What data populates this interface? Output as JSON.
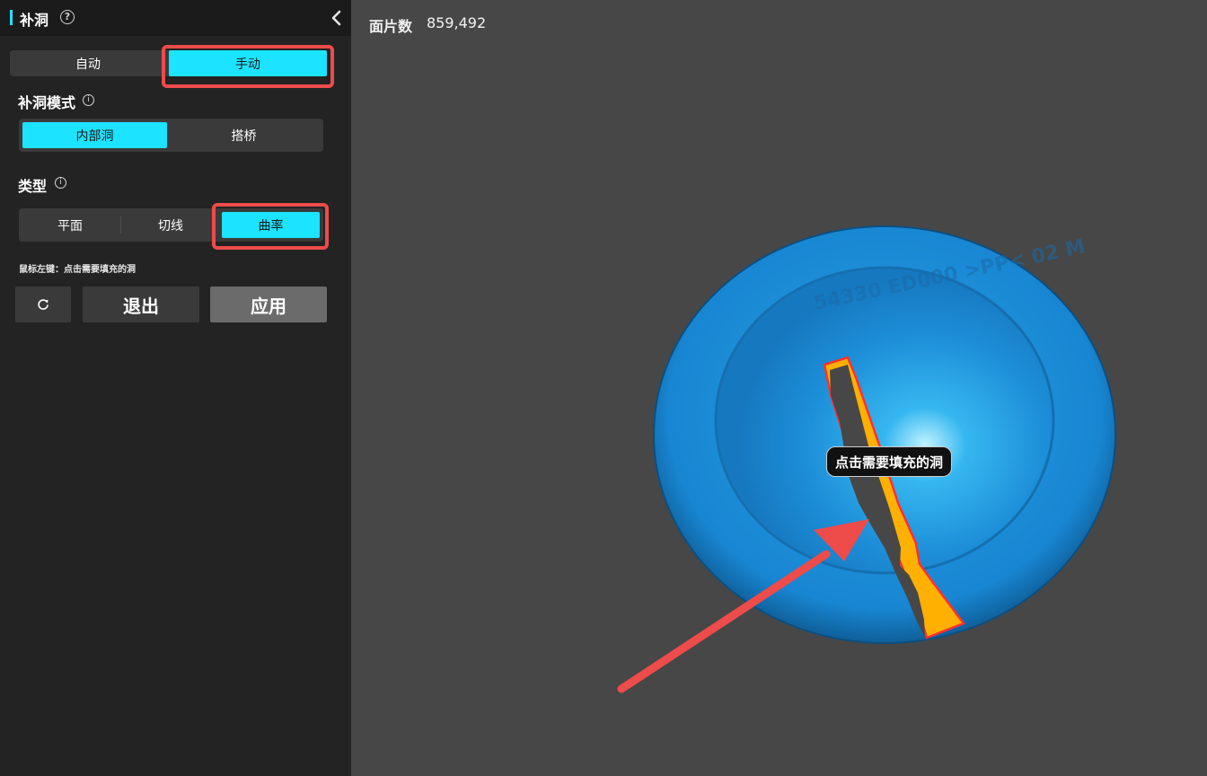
{
  "panel": {
    "title": "补洞",
    "help_symbol": "?",
    "fill_mode_tabs": [
      {
        "label": "自动",
        "active": false
      },
      {
        "label": "手动",
        "active": true
      }
    ],
    "mode_section": {
      "label": "补洞模式",
      "info_symbol": "i",
      "options": [
        {
          "label": "内部洞",
          "active": true
        },
        {
          "label": "搭桥",
          "active": false
        }
      ]
    },
    "type_section": {
      "label": "类型",
      "info_symbol": "i",
      "options": [
        {
          "label": "平面",
          "active": false
        },
        {
          "label": "切线",
          "active": false
        },
        {
          "label": "曲率",
          "active": true
        }
      ]
    },
    "hint": "鼠标左键：点击需要填充的洞",
    "buttons": {
      "exit_label": "退出",
      "apply_label": "应用"
    }
  },
  "viewport": {
    "face_count_label": "面片数",
    "face_count_value": "859,492",
    "tooltip": "点击需要填充的洞",
    "model_embossed_text": "54330 ED000 >PP< 02 M"
  },
  "colors": {
    "accent": "#1ce3ff",
    "highlight": "#ee4b4b",
    "model_blue": "#1f8fd8",
    "hole_boundary": "#ffb000"
  },
  "icons": {
    "help": "question-circle-icon",
    "collapse": "chevron-left-icon",
    "info": "info-circle-icon",
    "reset": "refresh-icon"
  }
}
